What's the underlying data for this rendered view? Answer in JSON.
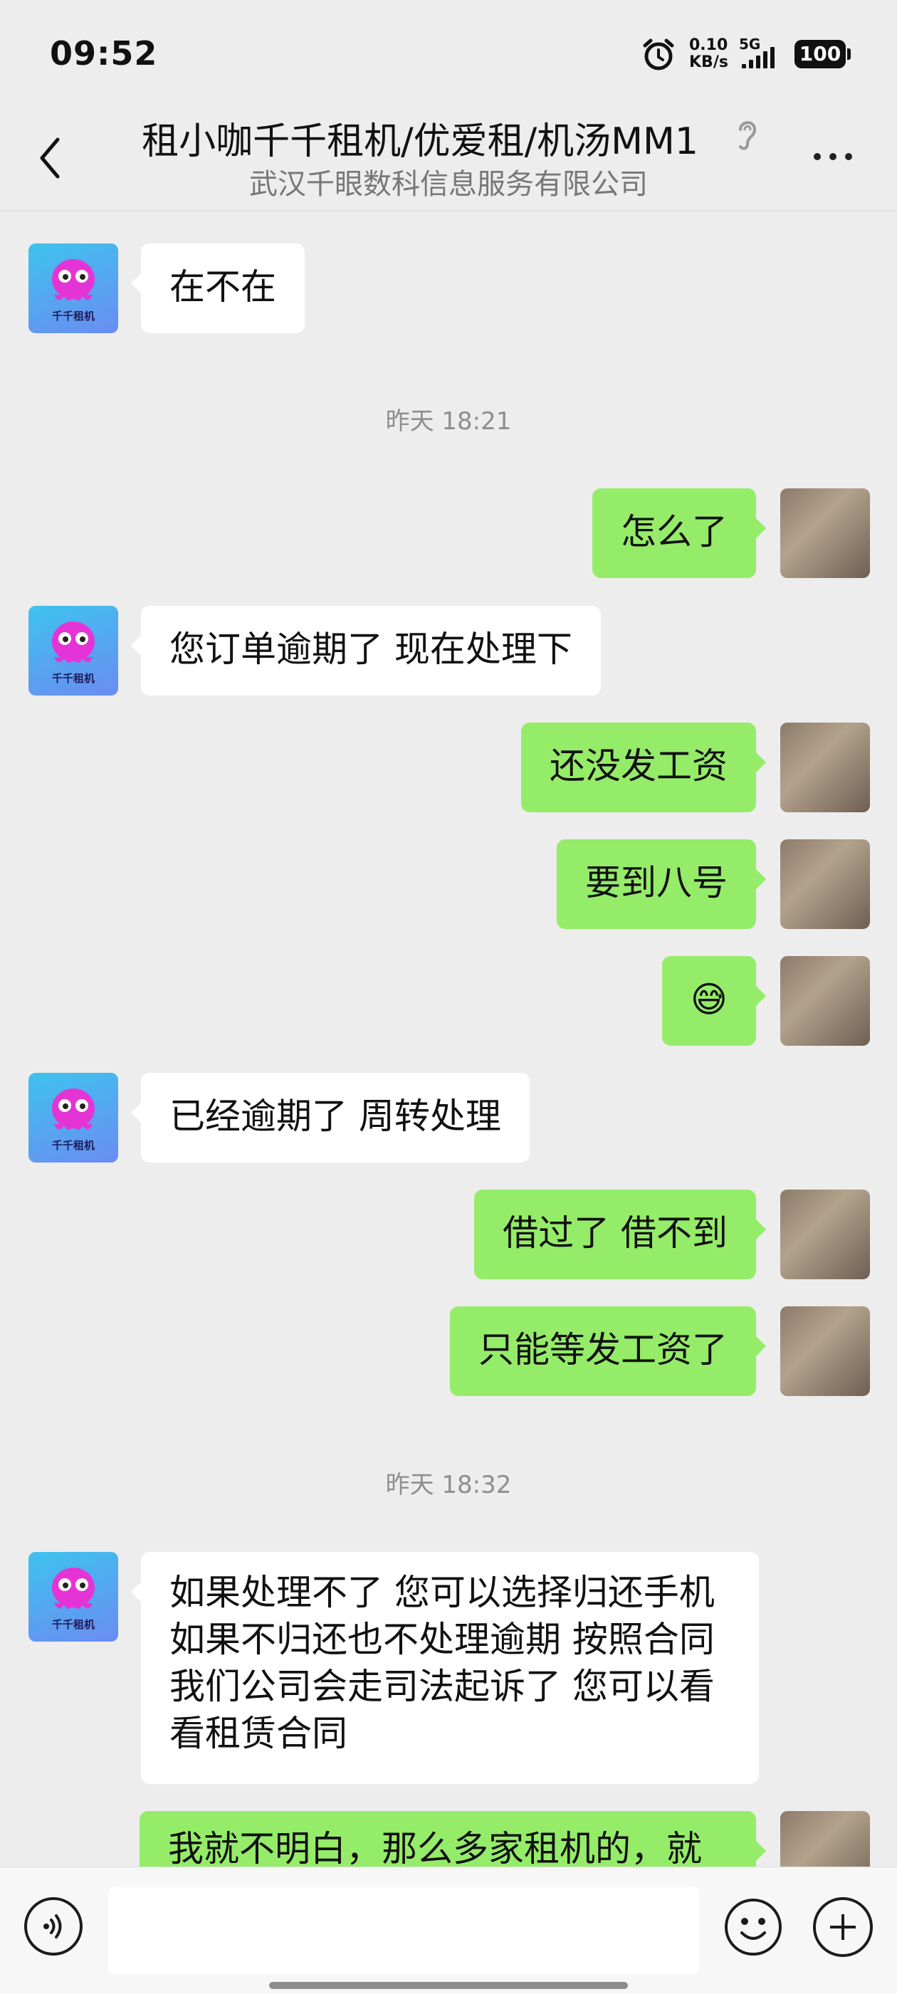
{
  "status_bar": {
    "time": "09:52",
    "net_speed": "0.10",
    "net_unit": "KB/s",
    "signal_label": "5G",
    "battery": "100"
  },
  "header": {
    "title": "租小咖千千租机/优爱租/机汤MM1",
    "subtitle": "武汉千眼数科信息服务有限公司"
  },
  "bot_avatar_caption": "千千租机",
  "timestamps": [
    "昨天 18:21",
    "昨天 18:32"
  ],
  "messages": [
    {
      "side": "in",
      "text": "在不在"
    },
    {
      "side": "out",
      "text": "怎么了"
    },
    {
      "side": "in",
      "text": "您订单逾期了 现在处理下"
    },
    {
      "side": "out",
      "text": "还没发工资"
    },
    {
      "side": "out",
      "text": "要到八号"
    },
    {
      "side": "out",
      "text": "😅"
    },
    {
      "side": "in",
      "text": "已经逾期了 周转处理"
    },
    {
      "side": "out",
      "text": "借过了 借不到"
    },
    {
      "side": "out",
      "text": "只能等发工资了"
    },
    {
      "side": "in",
      "text": "如果处理不了 您可以选择归还手机 如果不归还也不处理逾期 按照合同我们公司会走司法起诉了 您可以看看租赁合同"
    },
    {
      "side": "out",
      "text": "我就不明白，那么多家租机的，就"
    }
  ],
  "colors": {
    "background": "#ededed",
    "outgoing_bubble": "#95ec69",
    "incoming_bubble": "#ffffff",
    "timestamp": "#8e8e8e"
  },
  "icons": {
    "back": "back-arrow-icon",
    "ear": "ear-icon",
    "more": "more-dots-icon",
    "voice": "voice-icon",
    "emoji": "emoji-icon",
    "plus": "plus-icon",
    "alarm": "alarm-icon"
  }
}
